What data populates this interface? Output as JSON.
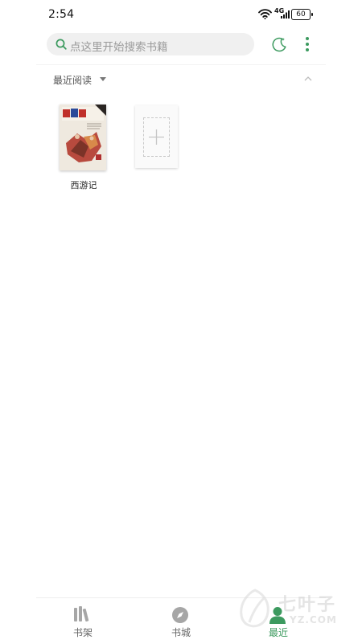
{
  "status_bar": {
    "time": "2:54",
    "signal_label": "4G",
    "battery": "60"
  },
  "search": {
    "placeholder": "点这里开始搜索书籍"
  },
  "section": {
    "title": "最近阅读"
  },
  "books": [
    {
      "title": "西游记"
    }
  ],
  "bottom_nav": [
    {
      "label": "书架",
      "icon": "bookshelf-icon",
      "active": false
    },
    {
      "label": "书城",
      "icon": "compass-icon",
      "active": false
    },
    {
      "label": "最近",
      "icon": "person-icon",
      "active": true
    }
  ],
  "watermark": {
    "text": "七叶子",
    "url": "YZ.COM"
  },
  "colors": {
    "accent": "#3c9a5f",
    "search_bg": "#f0f0f0",
    "nav_inactive": "#666666"
  }
}
